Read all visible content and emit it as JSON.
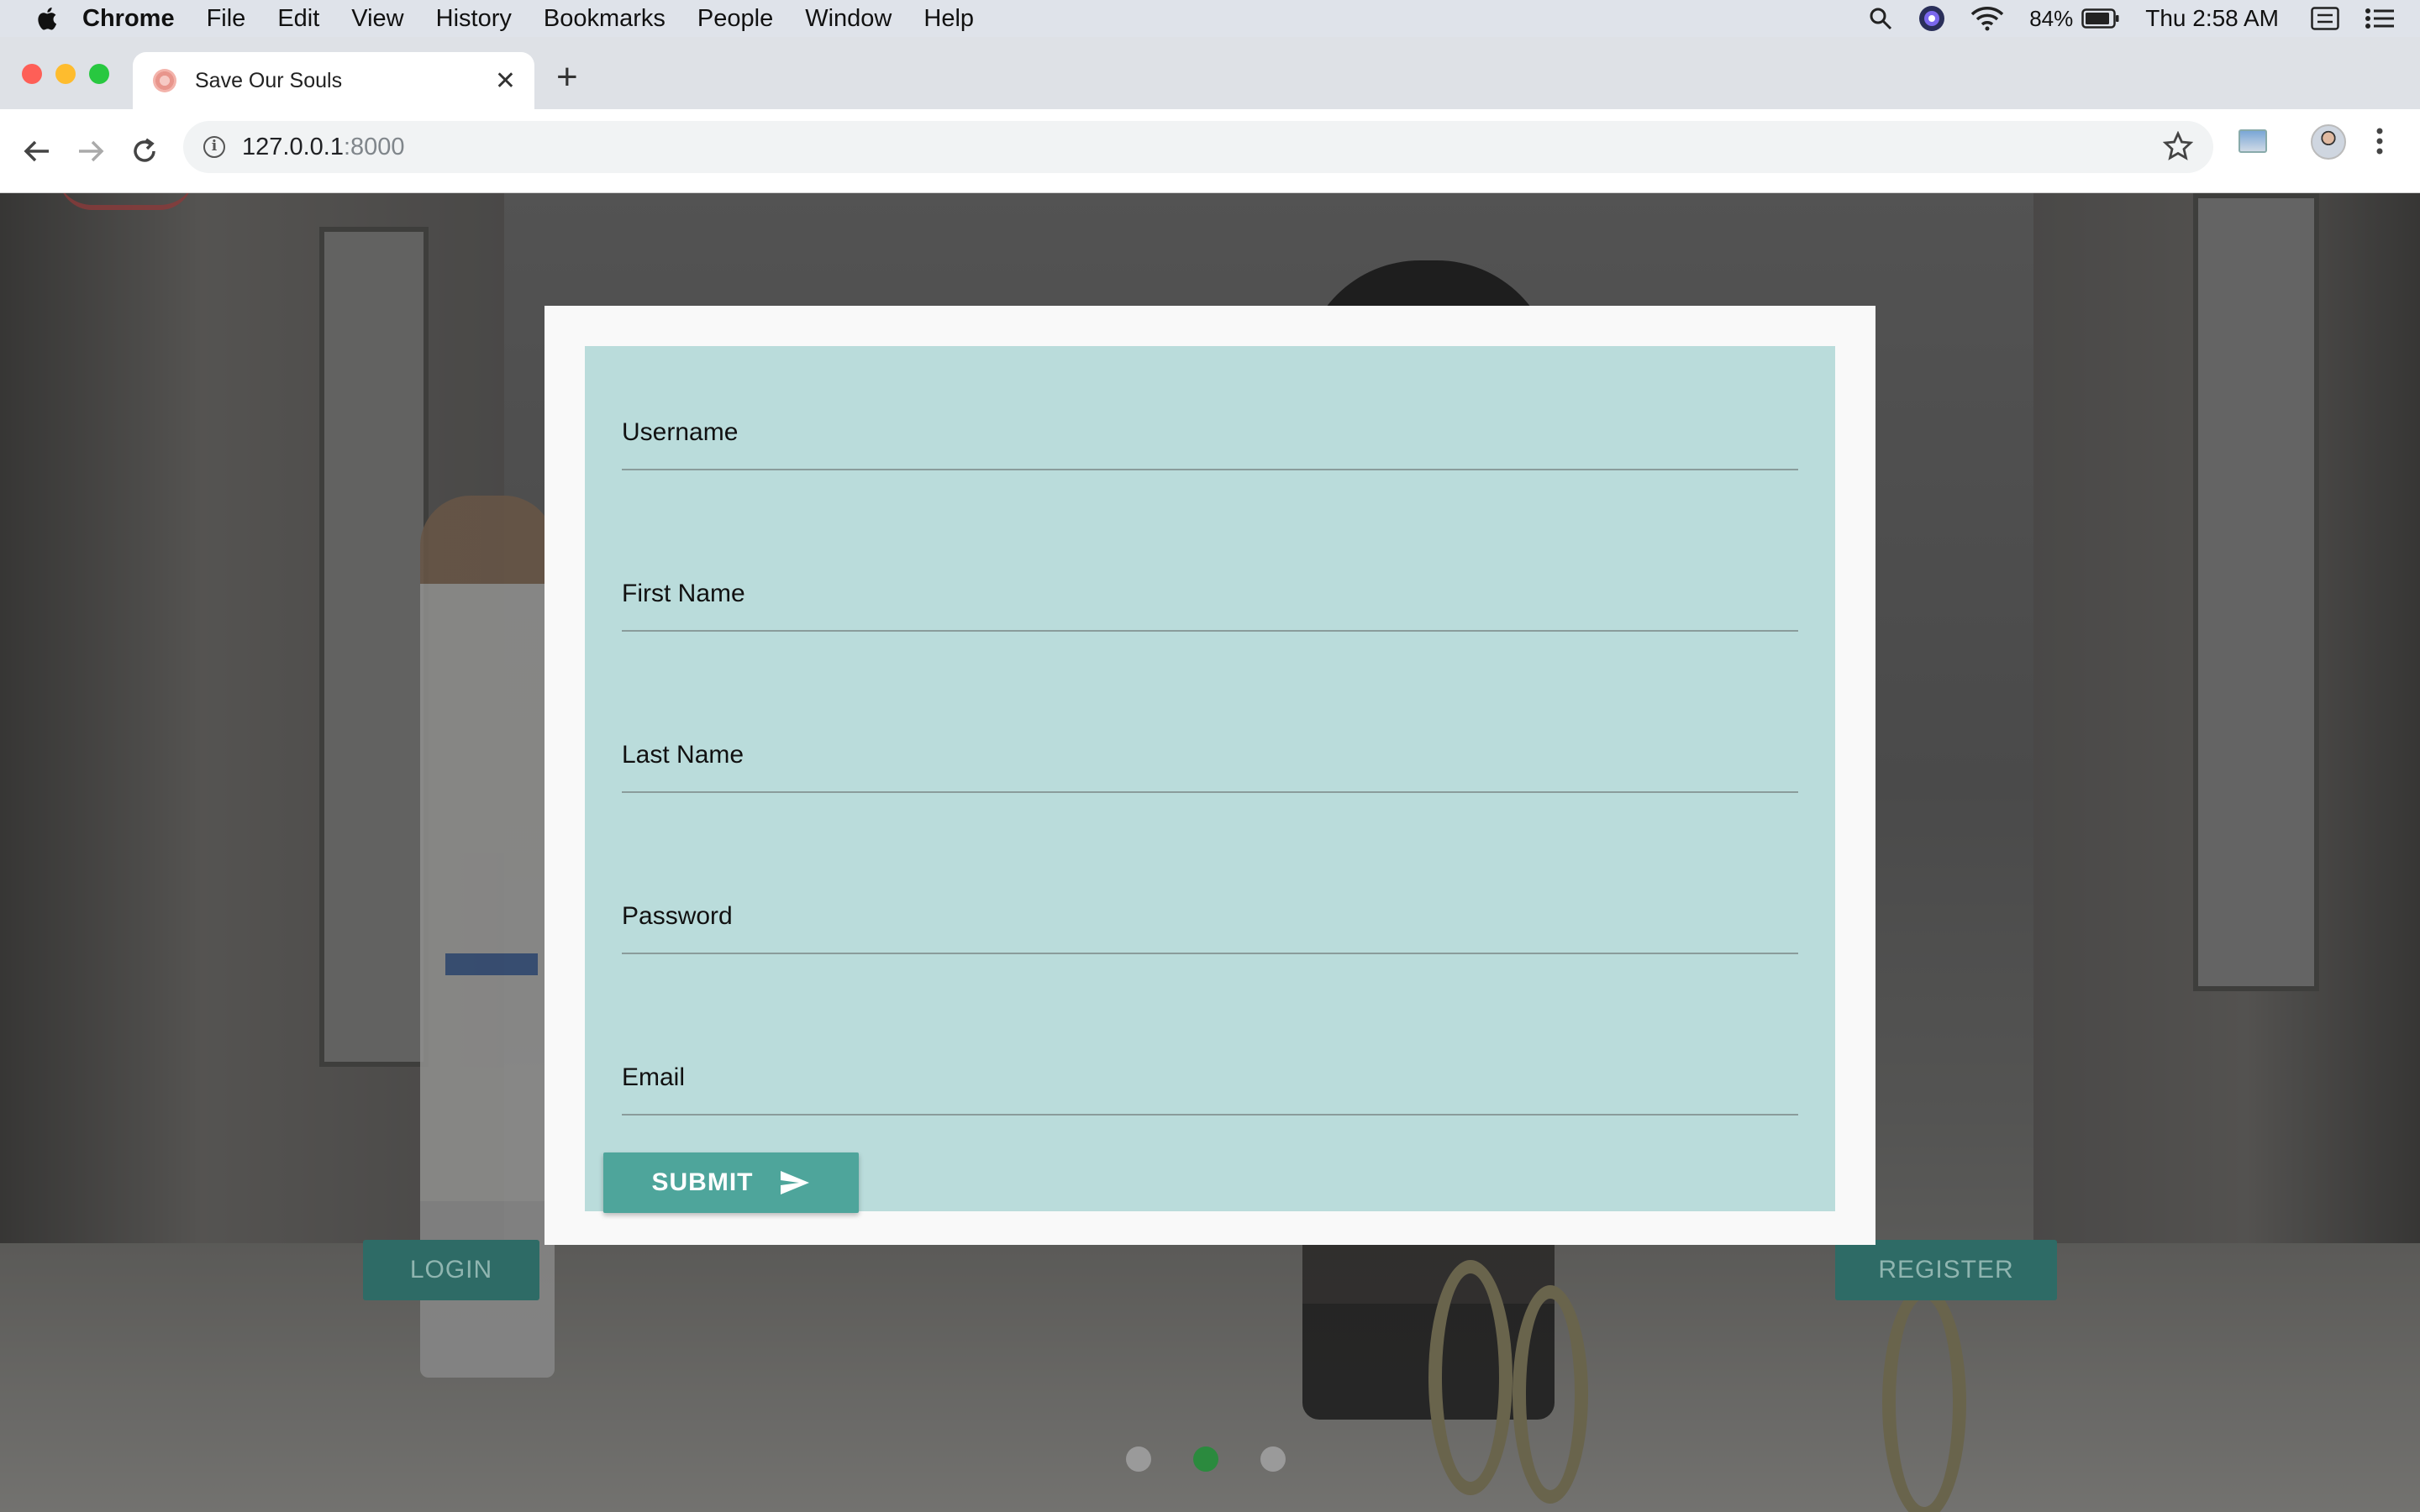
{
  "menubar": {
    "app_name": "Chrome",
    "items": [
      "File",
      "Edit",
      "View",
      "History",
      "Bookmarks",
      "People",
      "Window",
      "Help"
    ],
    "battery": "84%",
    "clock": "Thu 2:58 AM",
    "icons": [
      "search-icon",
      "siri-icon",
      "wifi-icon",
      "battery-icon",
      "control-center-icon",
      "notification-list-icon"
    ]
  },
  "browser": {
    "tab_title": "Save Our Souls",
    "url_host": "127.0.0.1",
    "url_port": ":8000",
    "new_tab_symbol": "+",
    "close_symbol": "✕"
  },
  "form": {
    "fields": [
      {
        "label": "Username",
        "value": ""
      },
      {
        "label": "First Name",
        "value": ""
      },
      {
        "label": "Last Name",
        "value": ""
      },
      {
        "label": "Password",
        "value": ""
      },
      {
        "label": "Email",
        "value": ""
      }
    ],
    "submit_label": "SUBMIT"
  },
  "page": {
    "login_label": "LOGIN",
    "register_label": "REGISTER",
    "carousel": {
      "count": 3,
      "active_index": 1
    }
  },
  "colors": {
    "form_panel": "#badcdb",
    "submit": "#4ea59b",
    "page_buttons": "#2e6b66",
    "carousel_active": "#2b8a3e"
  }
}
